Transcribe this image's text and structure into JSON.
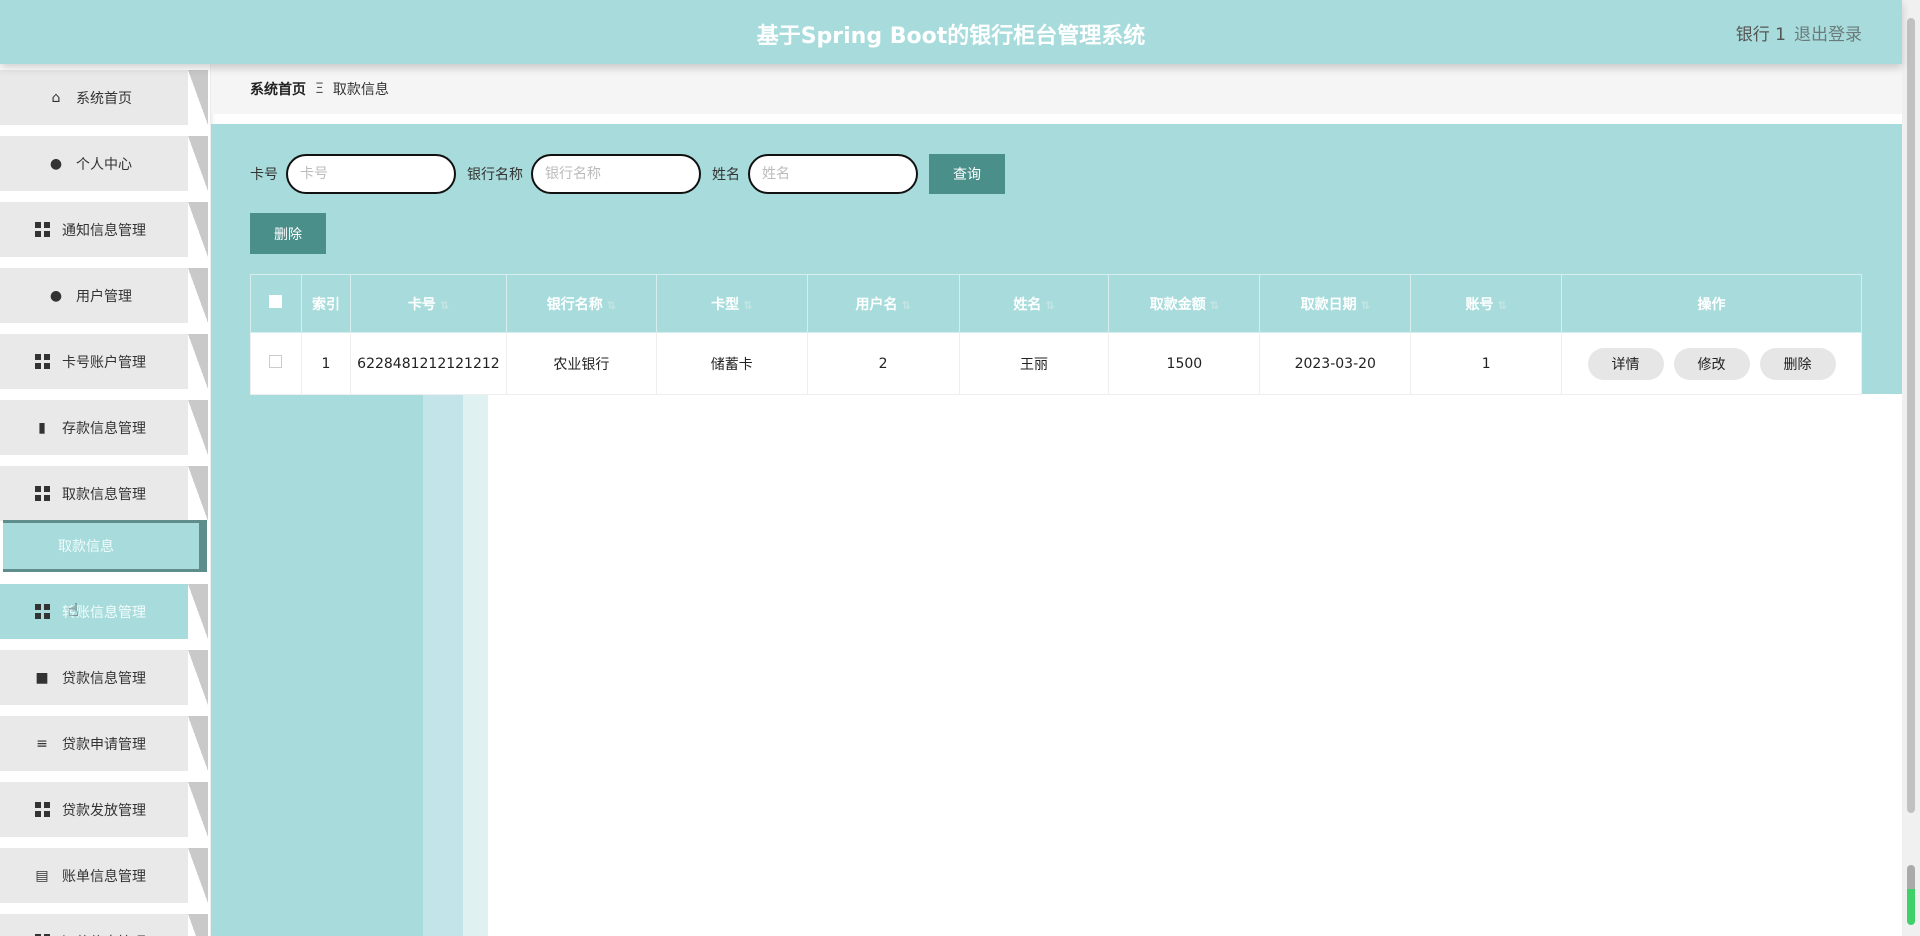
{
  "header": {
    "title": "基于Spring Boot的银行柜台管理系统",
    "user": "银行 1",
    "logout": "退出登录"
  },
  "sidebar": {
    "items": [
      {
        "label": "系统首页",
        "icon": "home-icon"
      },
      {
        "label": "个人中心",
        "icon": "user-icon"
      },
      {
        "label": "通知信息管理",
        "icon": "grid-icon"
      },
      {
        "label": "用户管理",
        "icon": "bulb-icon"
      },
      {
        "label": "卡号账户管理",
        "icon": "grid-icon"
      },
      {
        "label": "存款信息管理",
        "icon": "bar-chart-icon"
      },
      {
        "label": "取款信息管理",
        "icon": "grid-icon"
      },
      {
        "label": "转账信息管理",
        "icon": "grid-icon"
      },
      {
        "label": "贷款信息管理",
        "icon": "briefcase-icon"
      },
      {
        "label": "贷款申请管理",
        "icon": "sliders-icon"
      },
      {
        "label": "贷款发放管理",
        "icon": "grid-icon"
      },
      {
        "label": "账单信息管理",
        "icon": "clipboard-icon"
      },
      {
        "label": "还款信息管理",
        "icon": "grid-icon"
      }
    ],
    "active_sub": "取款信息"
  },
  "breadcrumb": {
    "home": "系统首页",
    "sep": "Ξ",
    "current": "取款信息"
  },
  "search": {
    "card_label": "卡号",
    "card_placeholder": "卡号",
    "bank_label": "银行名称",
    "bank_placeholder": "银行名称",
    "name_label": "姓名",
    "name_placeholder": "姓名",
    "query": "查询"
  },
  "toolbar": {
    "delete": "删除"
  },
  "table": {
    "headers": [
      "索引",
      "卡号",
      "银行名称",
      "卡型",
      "用户名",
      "姓名",
      "取款金额",
      "取款日期",
      "账号",
      "操作"
    ],
    "rows": [
      [
        "1",
        "6228481212121212",
        "农业银行",
        "储蓄卡",
        "2",
        "王丽",
        "1500",
        "2023-03-20",
        "1"
      ]
    ],
    "actions": [
      "详情",
      "修改",
      "删除"
    ]
  },
  "colors": {
    "accent": "#a8dcdc",
    "button": "#4a8f8a"
  }
}
